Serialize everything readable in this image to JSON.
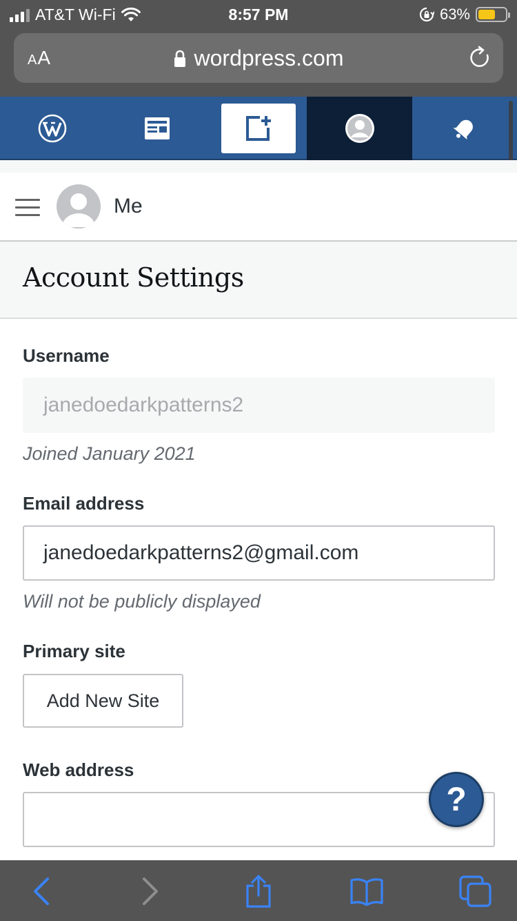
{
  "status_bar": {
    "carrier": "AT&T Wi-Fi",
    "time": "8:57 PM",
    "battery_percent": "63%",
    "battery_level": 0.63,
    "icons": [
      "signal-icon",
      "wifi-icon",
      "orientation-lock-icon",
      "battery-icon"
    ]
  },
  "browser": {
    "text_size_label_small": "A",
    "text_size_label_large": "A",
    "url": "wordpress.com",
    "toolbar_icons": [
      "back-icon",
      "forward-icon",
      "share-icon",
      "bookmarks-icon",
      "tabs-icon"
    ]
  },
  "masterbar": {
    "items": [
      "wordpress-logo-icon",
      "reader-icon",
      "write-icon",
      "me-avatar-icon",
      "notifications-icon"
    ],
    "active_item": "me-avatar-icon",
    "colors": {
      "bar": "#2c5a94",
      "active": "#0c1f36"
    }
  },
  "me_header": {
    "title": "Me"
  },
  "settings": {
    "title": "Account Settings",
    "username": {
      "label": "Username",
      "value": "janedoedarkpatterns2",
      "hint": "Joined January 2021"
    },
    "email": {
      "label": "Email address",
      "value": "janedoedarkpatterns2@gmail.com",
      "hint": "Will not be publicly displayed"
    },
    "primary_site": {
      "label": "Primary site",
      "button": "Add New Site"
    },
    "web_address": {
      "label": "Web address",
      "value": ""
    }
  },
  "help_button": {
    "label": "?"
  }
}
